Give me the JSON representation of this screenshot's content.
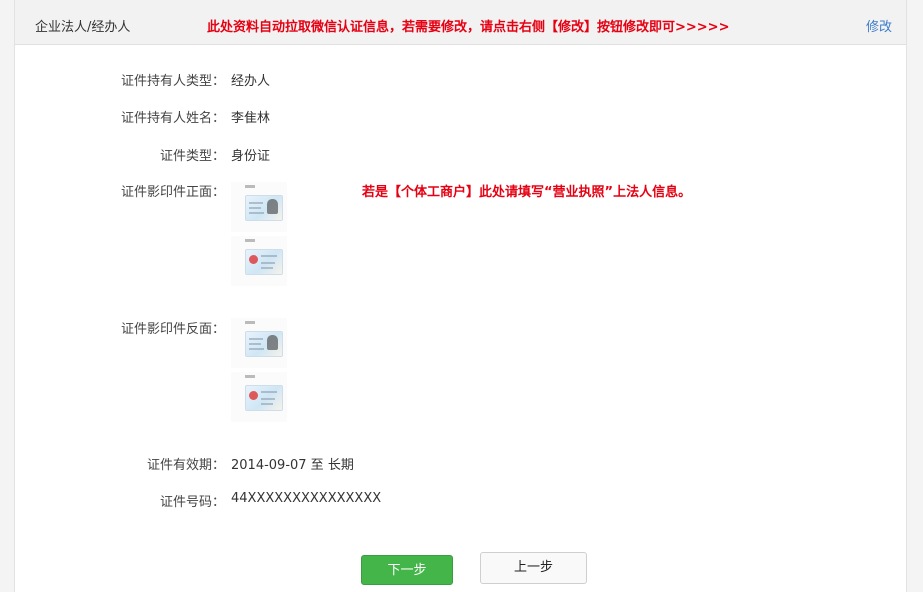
{
  "header": {
    "title": "企业法人/经办人",
    "notice": "此处资料自动拉取微信认证信息，若需要修改，请点击右侧【修改】按钮修改即可>>>>>",
    "edit_label": "修改"
  },
  "form": {
    "holder_type": {
      "label": "证件持有人类型：",
      "value": "经办人"
    },
    "holder_name": {
      "label": "证件持有人姓名：",
      "value": "李隹林"
    },
    "id_type": {
      "label": "证件类型：",
      "value": "身份证"
    },
    "front_copy": {
      "label": "证件影印件正面："
    },
    "back_copy": {
      "label": "证件影印件反面："
    },
    "validity": {
      "label": "证件有效期：",
      "value": "2014-09-07 至 长期"
    },
    "id_number": {
      "label": "证件号码：",
      "value": "44XXXXXXXXXXXXXXX"
    }
  },
  "hint": "若是【个体工商户】此处请填写“营业执照”上法人信息。",
  "buttons": {
    "next_label": "下一步",
    "prev_label": "上一步"
  },
  "colors": {
    "notice_red": "#e60012",
    "link_blue": "#3d7cc9",
    "primary_green": "#44b549"
  }
}
